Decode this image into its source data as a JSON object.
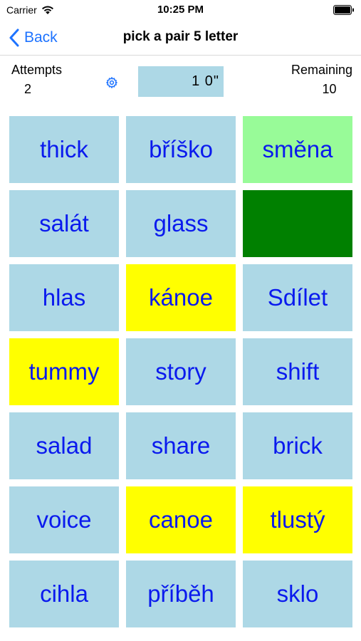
{
  "status_bar": {
    "carrier": "Carrier",
    "time": "10:25 PM"
  },
  "nav": {
    "back_label": "Back",
    "title": "pick a pair 5 letter"
  },
  "info": {
    "attempts_label": "Attempts",
    "attempts_value": "2",
    "timer": "1 0\"",
    "remaining_label": "Remaining",
    "remaining_value": "10"
  },
  "colors": {
    "default_tile": "#add8e6",
    "selected_tile": "#ffff00",
    "matched_tile": "#98fb98",
    "solved_tile": "#008000",
    "tile_text": "#0a1aee",
    "accent": "#1e73ff"
  },
  "tiles": [
    {
      "text": "thick",
      "state": "default"
    },
    {
      "text": "bříško",
      "state": "default"
    },
    {
      "text": "směna",
      "state": "matched"
    },
    {
      "text": "salát",
      "state": "default"
    },
    {
      "text": "glass",
      "state": "default"
    },
    {
      "text": "",
      "state": "solved"
    },
    {
      "text": "hlas",
      "state": "default"
    },
    {
      "text": "kánoe",
      "state": "selected"
    },
    {
      "text": "Sdílet",
      "state": "default"
    },
    {
      "text": "tummy",
      "state": "selected"
    },
    {
      "text": "story",
      "state": "default"
    },
    {
      "text": "shift",
      "state": "default"
    },
    {
      "text": "salad",
      "state": "default"
    },
    {
      "text": "share",
      "state": "default"
    },
    {
      "text": "brick",
      "state": "default"
    },
    {
      "text": "voice",
      "state": "default"
    },
    {
      "text": "canoe",
      "state": "selected"
    },
    {
      "text": "tlustý",
      "state": "selected"
    },
    {
      "text": "cihla",
      "state": "default"
    },
    {
      "text": "příběh",
      "state": "default"
    },
    {
      "text": "sklo",
      "state": "default"
    }
  ]
}
